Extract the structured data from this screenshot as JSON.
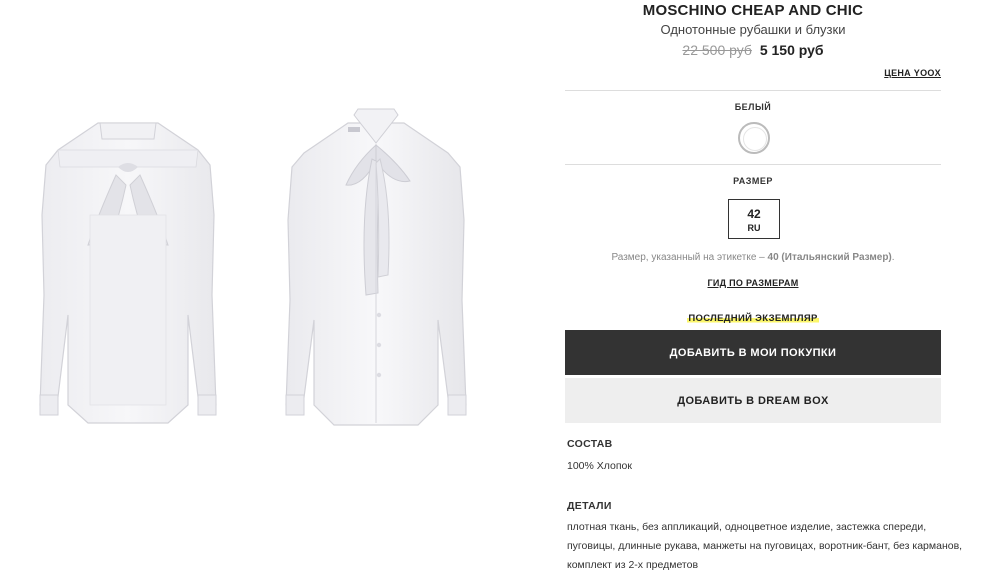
{
  "product": {
    "brand": "MOSCHINO CHEAP AND CHIC",
    "category": "Однотонные рубашки и блузки",
    "price_old": "22 500 руб",
    "price_new": "5 150 руб",
    "price_link": "ЦЕНА YOOX"
  },
  "color": {
    "label": "БЕЛЫЙ",
    "swatch_color": "#ffffff"
  },
  "size": {
    "label": "РАЗМЕР",
    "value": "42",
    "region": "RU",
    "note_prefix": "Размер, указанный на этикетке – ",
    "note_bold": "40 (Итальянский Размер)",
    "note_suffix": ".",
    "guide_link": "ГИД ПО РАЗМЕРАМ"
  },
  "stock": {
    "label": "ПОСЛЕДНИЙ ЭКЗЕМПЛЯР",
    "highlight_color": "#fbf66a"
  },
  "actions": {
    "buy_label": "ДОБАВИТЬ В МОИ ПОКУПКИ",
    "dream_label": "ДОБАВИТЬ В DREAM BOX"
  },
  "composition": {
    "title": "СОСТАВ",
    "text": "100% Хлопок"
  },
  "details": {
    "title": "ДЕТАЛИ",
    "line1": "плотная ткань, без аппликаций, одноцветное изделие, застежка спереди,",
    "line2": "пуговицы, длинные рукава, манжеты на пуговицах, воротник-бант, без карманов,",
    "line3": "комплект из 2-х предметов"
  },
  "gallery": {
    "images": [
      "blouse-back",
      "blouse-front"
    ]
  },
  "colors": {
    "button_dark": "#333333",
    "button_light": "#eeeeee"
  }
}
